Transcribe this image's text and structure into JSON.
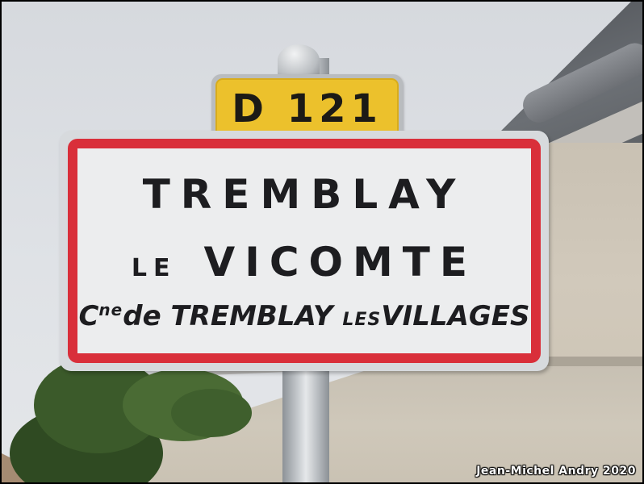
{
  "road_plate": {
    "number": "D 121"
  },
  "town_sign": {
    "line1": "TREMBLAY",
    "line2_prefix": "LE",
    "line2_main": "VICOMTE",
    "line3": {
      "c": "C",
      "ne": "ne",
      "de": "de",
      "tremblay": "TREMBLAY",
      "les": "LES",
      "villages": "VILLAGES"
    }
  },
  "photo_credit": "Jean-Michel Andry 2020",
  "colors": {
    "sign_border": "#d92f3a",
    "road_plate": "#ecc12c",
    "sign_face": "#ecedee"
  }
}
